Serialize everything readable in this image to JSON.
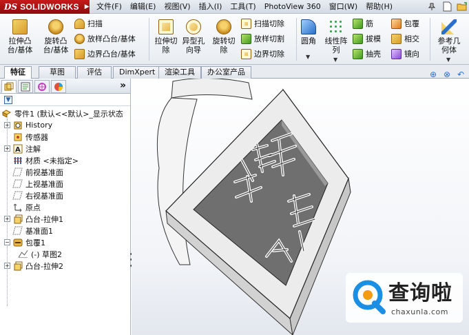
{
  "app": {
    "logo_mark": "DS",
    "logo_text": "SOLIDWORKS",
    "logo_arrow": "▶"
  },
  "menu": [
    "文件(F)",
    "编辑(E)",
    "视图(V)",
    "插入(I)",
    "工具(T)",
    "PhotoView 360",
    "窗口(W)",
    "帮助(H)"
  ],
  "ribbon": {
    "extrude_boss": [
      "拉伸凸",
      "台/基体"
    ],
    "revolve_boss": [
      "旋转凸",
      "台/基体"
    ],
    "sweep": "扫描",
    "loft_boss": "放样凸台/基体",
    "boundary_boss": "边界凸台/基体",
    "extrude_cut": [
      "拉伸切",
      "除"
    ],
    "hole_wizard": [
      "异型孔",
      "向导"
    ],
    "revolve_cut": [
      "旋转切",
      "除"
    ],
    "sweep_cut": "扫描切除",
    "loft_cut": "放样切割",
    "boundary_cut": "边界切除",
    "fillet": "圆角",
    "linear_pattern": [
      "线性阵",
      "列"
    ],
    "rib": "筋",
    "draft": "拔模",
    "shell": "抽壳",
    "wrap": "包覆",
    "intersect": "相交",
    "mirror": "镜向",
    "ref_geometry": [
      "参考几",
      "何体"
    ]
  },
  "tabs": [
    "特征",
    "草图",
    "评估",
    "DimXpert",
    "渲染工具",
    "办公室产品"
  ],
  "panel": {
    "expand": "»",
    "tree": [
      {
        "label": "零件1 (默认<<默认>_显示状态",
        "icon": "part-icon"
      },
      {
        "label": "History",
        "icon": "history-icon"
      },
      {
        "label": "传感器",
        "icon": "sensor-icon"
      },
      {
        "label": "注解",
        "icon": "annotation-icon"
      },
      {
        "label": "材质 <未指定>",
        "icon": "material-icon"
      },
      {
        "label": "前视基准面",
        "icon": "plane-icon"
      },
      {
        "label": "上视基准面",
        "icon": "plane-icon"
      },
      {
        "label": "右视基准面",
        "icon": "plane-icon"
      },
      {
        "label": "原点",
        "icon": "origin-icon"
      },
      {
        "label": "凸台-拉伸1",
        "icon": "extrude-icon"
      },
      {
        "label": "基准面1",
        "icon": "plane-icon"
      },
      {
        "label": "包覆1",
        "icon": "wrap-icon"
      },
      {
        "label": "(-) 草图2",
        "icon": "sketch-icon"
      },
      {
        "label": "凸台-拉伸2",
        "icon": "extrude-icon"
      }
    ]
  },
  "watermark": {
    "cn": "查询啦",
    "url": "chaxunla.com",
    "brand_color": "#1a8fe3"
  },
  "colors": {
    "logo_red": "#b51515",
    "model_face": "#e9e9e9",
    "model_recess": "#6f6f6f"
  }
}
